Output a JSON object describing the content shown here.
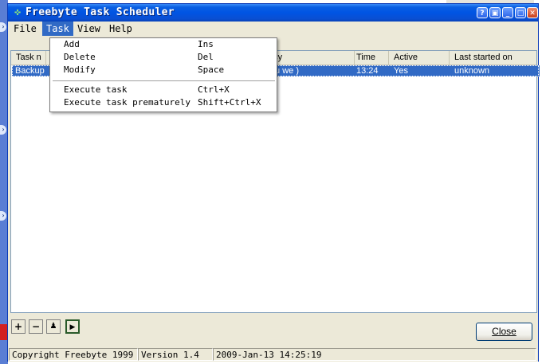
{
  "window": {
    "title": "Freebyte Task Scheduler"
  },
  "menubar": {
    "items": [
      "File",
      "Task",
      "View",
      "Help"
    ],
    "active": "Task"
  },
  "task_menu": {
    "items": [
      {
        "label": "Add",
        "shortcut": "Ins"
      },
      {
        "label": "Delete",
        "shortcut": "Del"
      },
      {
        "label": "Modify",
        "shortcut": "Space"
      },
      {
        "label": "Execute task",
        "shortcut": "Ctrl+X"
      },
      {
        "label": "Execute task prematurely",
        "shortcut": "Shift+Ctrl+X"
      }
    ]
  },
  "table": {
    "columns": [
      "Task n",
      "ncy",
      "Time",
      "Active",
      "Last started on"
    ],
    "rows": [
      {
        "name": "Backup",
        "frequency": "tu we )",
        "time": "13:24",
        "active": "Yes",
        "last_started": "unknown"
      }
    ]
  },
  "bottom_buttons": {
    "add": "+",
    "remove": "−",
    "run": "🏃",
    "execute": "▶"
  },
  "close_button": {
    "label": "Close"
  },
  "statusbar": {
    "copyright": "Copyright Freebyte 1999",
    "version": "Version 1.4",
    "datetime": "2009-Jan-13 14:25:19"
  },
  "colors": {
    "title_blue": "#0054e3",
    "selection": "#316ac5",
    "face": "#ece9d8"
  },
  "icons": [
    "app-icon",
    "minimize-icon",
    "maximize-icon",
    "close-icon",
    "add-icon",
    "remove-icon",
    "run-icon",
    "execute-icon"
  ]
}
